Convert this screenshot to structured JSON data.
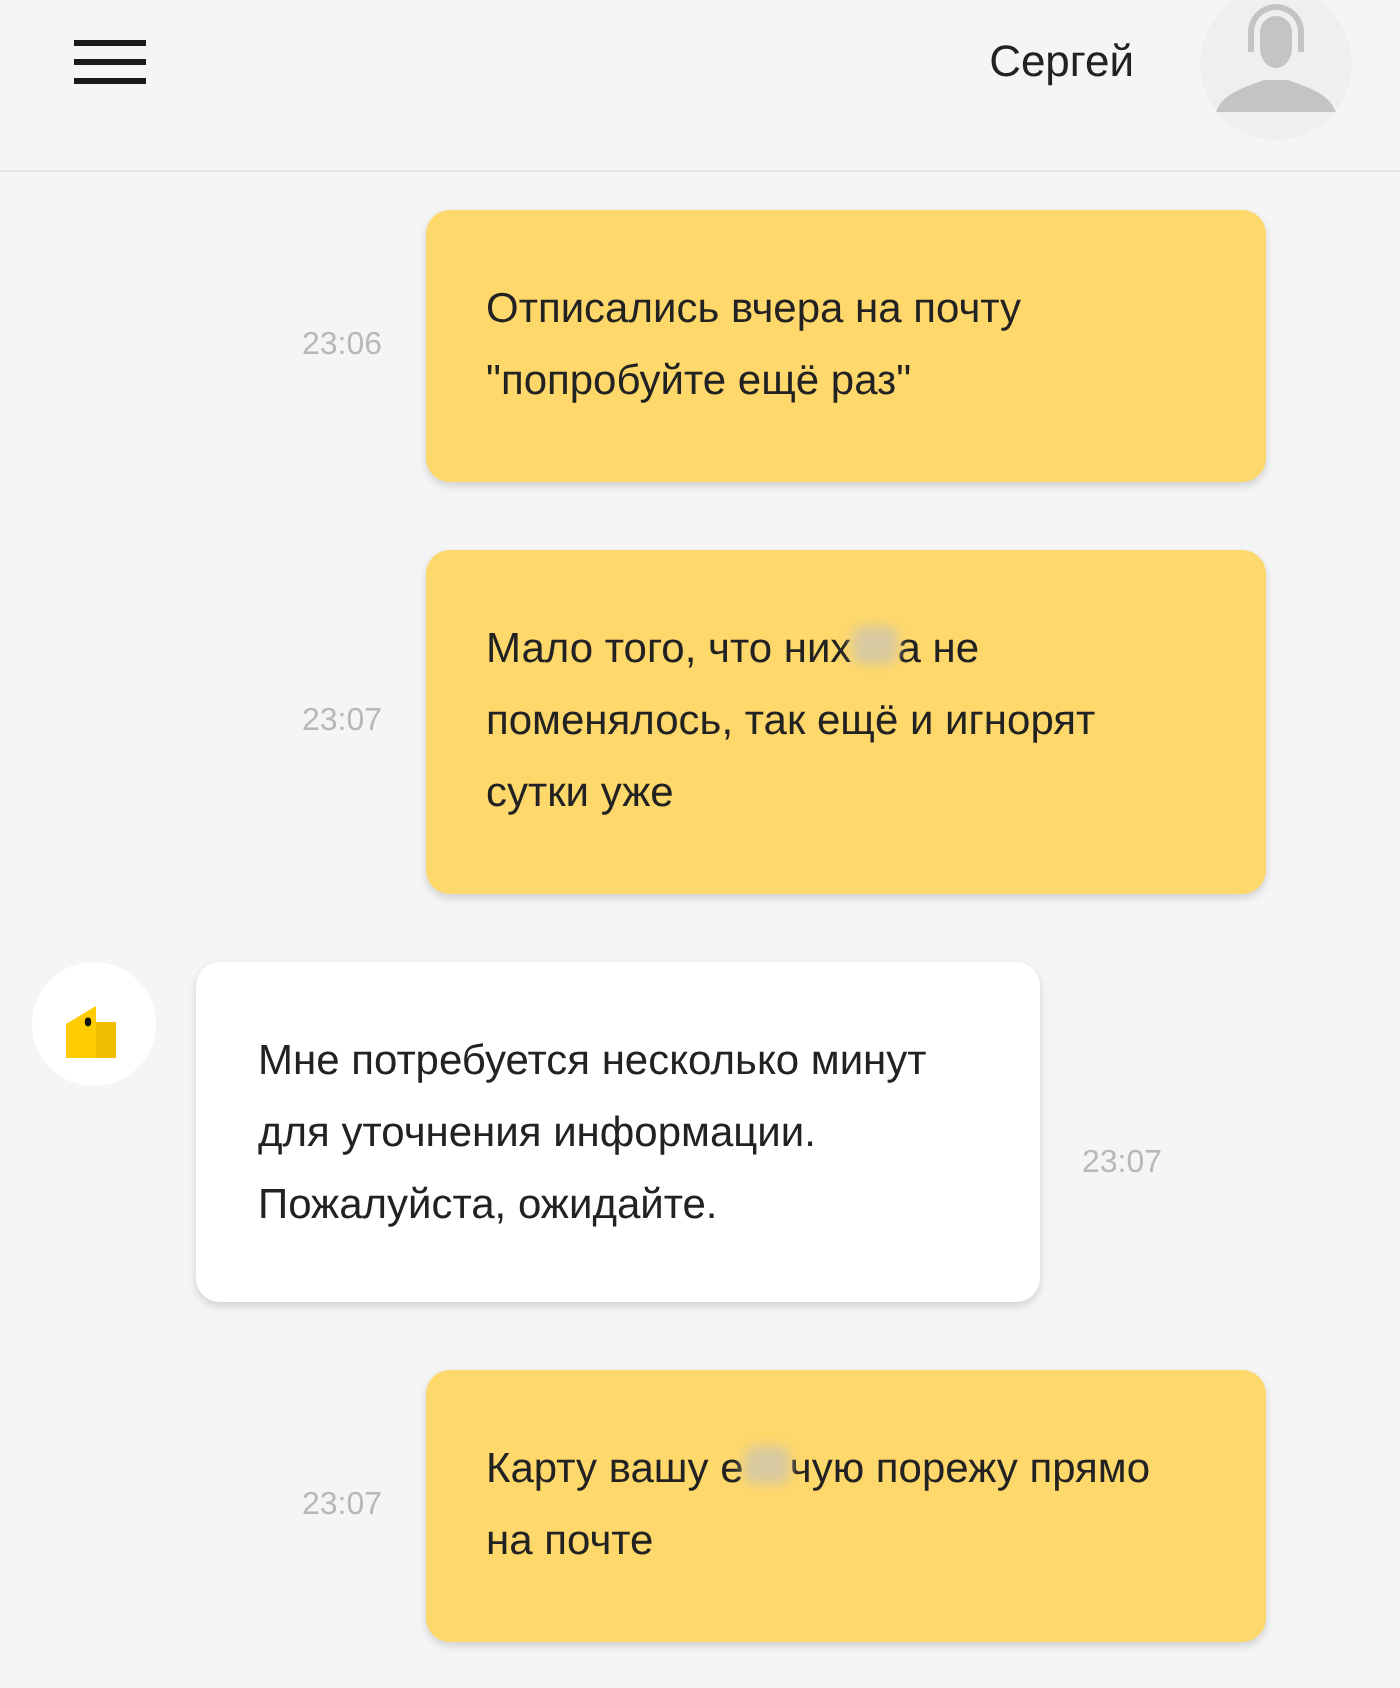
{
  "header": {
    "user_name": "Сергей"
  },
  "messages": [
    {
      "kind": "outgoing",
      "time": "23:06",
      "parts": [
        {
          "kind": "text",
          "text": "Отписались вчера на почту \"попробуйте ещё раз\""
        }
      ]
    },
    {
      "kind": "outgoing",
      "time": "23:07",
      "parts": [
        {
          "kind": "text",
          "text": "Мало того, что них"
        },
        {
          "kind": "blur"
        },
        {
          "kind": "text",
          "text": "а не поменялось, так ещё и игнорят сутки уже"
        }
      ]
    },
    {
      "kind": "incoming",
      "time": "23:07",
      "parts": [
        {
          "kind": "text",
          "text": "Мне потребуется несколько минут для уточнения информации. Пожалуйста, ожидайте."
        }
      ]
    },
    {
      "kind": "outgoing",
      "time": "23:07",
      "parts": [
        {
          "kind": "text",
          "text": "Карту вашу е"
        },
        {
          "kind": "blur"
        },
        {
          "kind": "text",
          "text": "чую порежу прямо на почте"
        }
      ]
    }
  ]
}
